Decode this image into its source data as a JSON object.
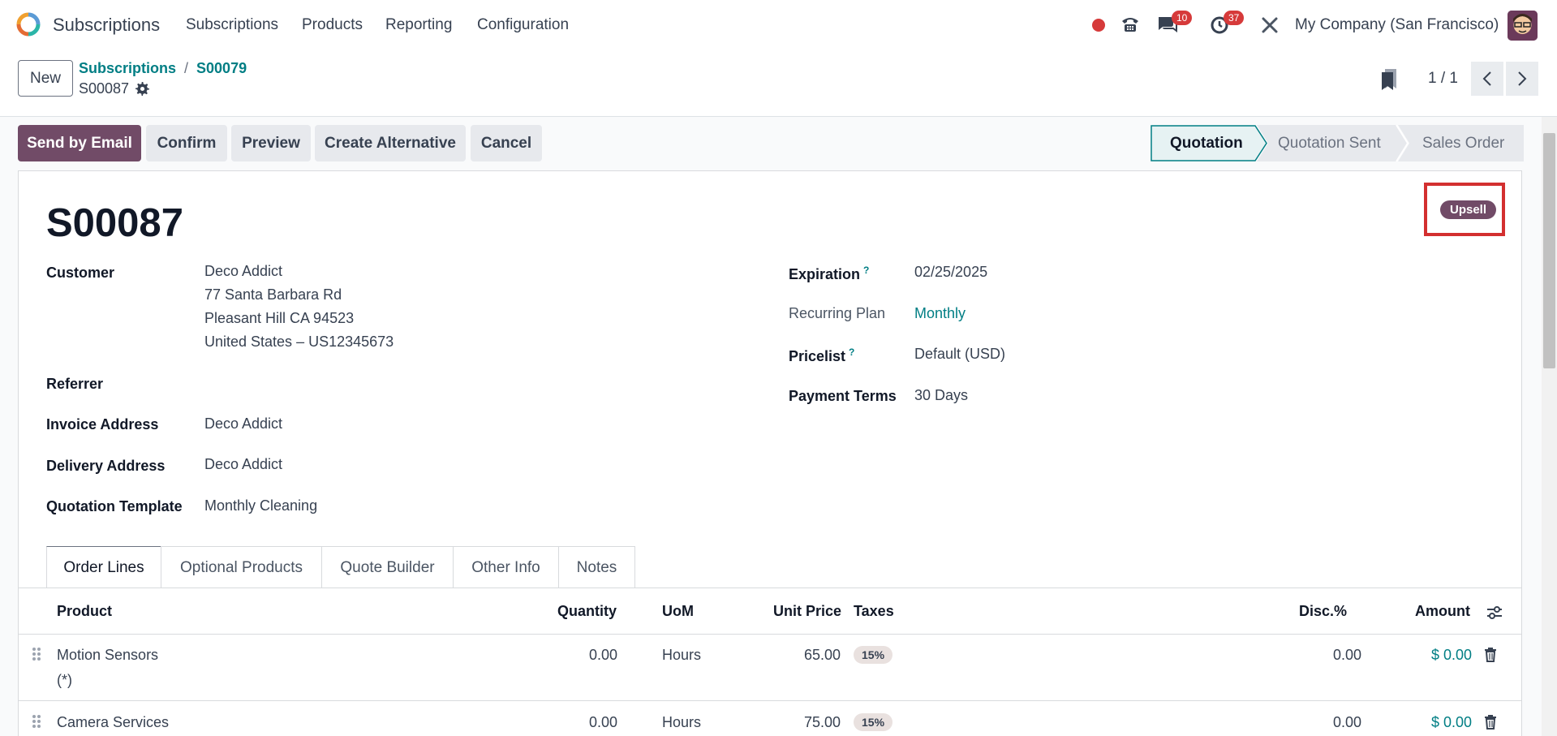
{
  "navbar": {
    "app_name": "Subscriptions",
    "menu": [
      "Subscriptions",
      "Products",
      "Reporting",
      "Configuration"
    ],
    "chat_badge": "10",
    "activity_badge": "37",
    "company": "My Company (San Francisco)"
  },
  "control_panel": {
    "new_label": "New",
    "breadcrumb": [
      "Subscriptions",
      "S00079"
    ],
    "record_name": "S00087",
    "pager": "1 / 1"
  },
  "actions": {
    "send_email": "Send by Email",
    "confirm": "Confirm",
    "preview": "Preview",
    "create_alternative": "Create Alternative",
    "cancel": "Cancel"
  },
  "statusbar": [
    "Quotation",
    "Quotation Sent",
    "Sales Order"
  ],
  "form": {
    "title": "S00087",
    "ribbon": "Upsell",
    "customer_label": "Customer",
    "customer_lines": [
      "Deco Addict",
      "77 Santa Barbara Rd",
      "Pleasant Hill CA 94523",
      "United States – US12345673"
    ],
    "referrer_label": "Referrer",
    "invoice_label": "Invoice Address",
    "invoice_value": "Deco Addict",
    "delivery_label": "Delivery Address",
    "delivery_value": "Deco Addict",
    "template_label": "Quotation Template",
    "template_value": "Monthly Cleaning",
    "expiration_label": "Expiration",
    "expiration_value": "02/25/2025",
    "plan_label": "Recurring Plan",
    "plan_value": "Monthly",
    "pricelist_label": "Pricelist",
    "pricelist_value": "Default (USD)",
    "terms_label": "Payment Terms",
    "terms_value": "30 Days",
    "help_mark": "?"
  },
  "tabs": [
    "Order Lines",
    "Optional Products",
    "Quote Builder",
    "Other Info",
    "Notes"
  ],
  "table": {
    "headers": {
      "product": "Product",
      "quantity": "Quantity",
      "uom": "UoM",
      "unit_price": "Unit Price",
      "taxes": "Taxes",
      "disc": "Disc.%",
      "amount": "Amount"
    },
    "rows": [
      {
        "product": "Motion Sensors",
        "note": "(*)",
        "quantity": "0.00",
        "uom": "Hours",
        "unit_price": "65.00",
        "tax": "15%",
        "disc": "0.00",
        "amount": "$ 0.00"
      },
      {
        "product": "Camera Services",
        "quantity": "0.00",
        "uom": "Hours",
        "unit_price": "75.00",
        "tax": "15%",
        "disc": "0.00",
        "amount": "$ 0.00"
      }
    ]
  },
  "colors": {
    "brand": "#714b67",
    "link": "#017e84",
    "badge": "#d63a3a",
    "highlight": "#d32f2f"
  },
  "icons": [
    "odoo-logo-icon",
    "recording-dot-icon",
    "phone-icon",
    "chat-icon",
    "clock-icon",
    "tools-icon",
    "gear-icon",
    "bookmark-icon",
    "chevron-left-icon",
    "chevron-right-icon",
    "column-settings-icon",
    "trash-icon",
    "drag-handle-icon"
  ]
}
